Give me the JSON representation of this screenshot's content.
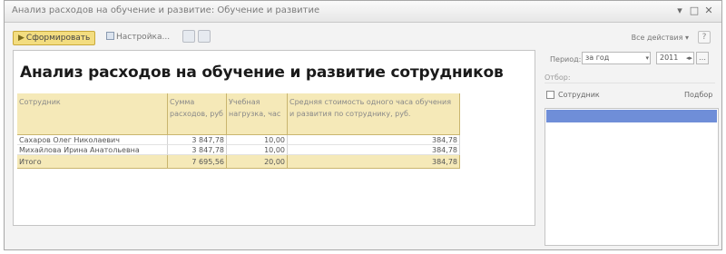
{
  "window": {
    "title": "Анализ расходов на обучение и развитие: Обучение и развитие"
  },
  "toolbar": {
    "generate_label": "Сформировать",
    "settings_label": "Настройка...",
    "all_actions_label": "Все действия",
    "help_label": "?"
  },
  "report": {
    "title": "Анализ расходов на обучение и развитие сотрудников",
    "columns": [
      "Сотрудник",
      "Сумма расходов, руб",
      "Учебная нагрузка, час",
      "Средняя стоимость одного часа обучения и развития по сотруднику, руб."
    ],
    "rows": [
      [
        "Сахаров Олег Николаевич",
        "3 847,78",
        "10,00",
        "384,78"
      ],
      [
        "Михайлова Ирина Анатольевна",
        "3 847,78",
        "10,00",
        "384,78"
      ]
    ],
    "total": [
      "Итого",
      "7 695,56",
      "20,00",
      "384,78"
    ]
  },
  "panel": {
    "period_label": "Период:",
    "period_value": "за год",
    "year_value": "2011",
    "selection_label": "Отбор:",
    "employees_label": "Сотрудник",
    "pick_label": "Подбор"
  },
  "colors": {
    "accent": "#f3dd80",
    "table_header": "#f5e9b8",
    "list_selection": "#6f8ed8"
  }
}
